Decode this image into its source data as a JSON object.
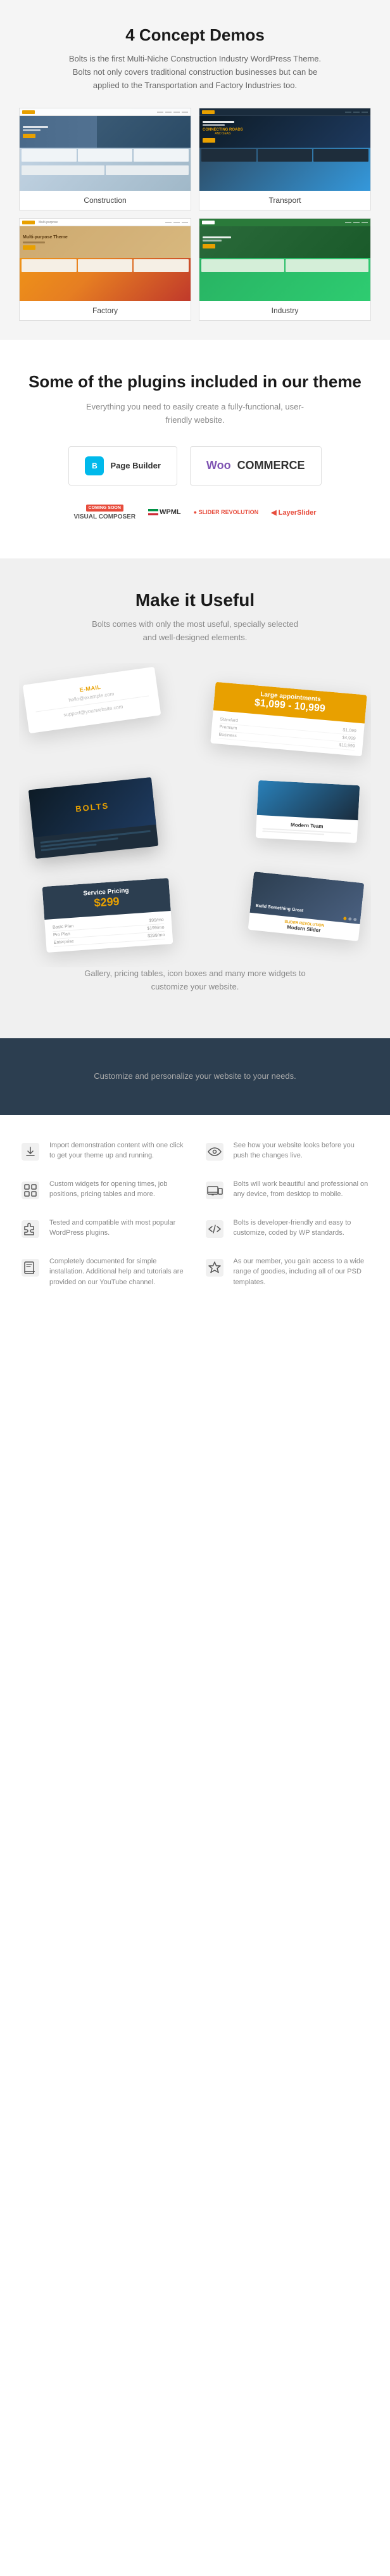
{
  "section_demos": {
    "title": "4 Concept Demos",
    "description": "Bolts is the first Multi-Niche Construction Industry WordPress Theme. Bolts not only covers traditional construction businesses but can be applied to the Transportation and Factory Industries too.",
    "demos": [
      {
        "id": "construction",
        "label": "Construction",
        "theme": "construction"
      },
      {
        "id": "transport",
        "label": "Transport",
        "theme": "transport"
      },
      {
        "id": "factory",
        "label": "Factory",
        "theme": "factory"
      },
      {
        "id": "industry",
        "label": "Industry",
        "theme": "industry"
      }
    ]
  },
  "section_plugins": {
    "title": "Some of the plugins included in our theme",
    "description": "Everything you need to easily create a fully-functional, user-friendly website.",
    "plugins": [
      {
        "id": "page-builder",
        "label": "Page Builder"
      },
      {
        "id": "woocommerce",
        "label": "WooCommerce"
      }
    ],
    "additional_plugins": [
      {
        "id": "visual-composer",
        "label": "Visual Composer",
        "badge": "COMING SOON"
      },
      {
        "id": "wpml",
        "label": "WPML"
      },
      {
        "id": "slider-revolution",
        "label": "SLIDER REVOLUTION"
      },
      {
        "id": "layer-slider",
        "label": "LayerSlider"
      }
    ]
  },
  "section_useful": {
    "title": "Make it Useful",
    "description": "Bolts comes with only the most useful, specially selected and well-designed elements.",
    "caption": "Gallery, pricing tables, icon boxes and many more widgets to customize your website.",
    "elements": {
      "email": {
        "label": "E-Mail",
        "value1": "hello@example.com",
        "value2": "support@yourwebsite.com"
      },
      "appointments": {
        "title": "Large appointments",
        "price_range": "$1,099 - 10,999",
        "rows": [
          {
            "label": "Standard",
            "value": "$1,099"
          },
          {
            "label": "Premium",
            "value": "$4,999"
          },
          {
            "label": "Business",
            "value": "$10,999"
          }
        ]
      },
      "pricing": {
        "title": "Service Pricing",
        "amount": "$299",
        "rows": [
          {
            "label": "Basic Plan",
            "value": "$99/mo"
          },
          {
            "label": "Pro Plan",
            "value": "$199/mo"
          },
          {
            "label": "Enterprise",
            "value": "$299/mo"
          }
        ]
      },
      "slider": {
        "tag": "SLIDER REVOLUTION",
        "title": "Modern Slider",
        "hero_text": "Build Something Great"
      },
      "dark_site": {
        "logo_text": "BOLTS",
        "lines": 3
      },
      "team": {
        "title": "Modern Team",
        "lines": 2
      }
    }
  },
  "section_customize": {
    "description": "Customize and personalize your website to your needs."
  },
  "section_features": {
    "features": [
      {
        "id": "demo-import",
        "icon": "download",
        "title": "Import demonstration content with one click to get your theme up and running.",
        "description": ""
      },
      {
        "id": "preview",
        "icon": "eye",
        "title": "See how your website looks before you push the changes live.",
        "description": ""
      },
      {
        "id": "custom-widgets",
        "icon": "grid",
        "title": "Custom widgets for opening times, job positions, pricing tables and more.",
        "description": ""
      },
      {
        "id": "responsive",
        "icon": "devices",
        "title": "Bolts will work beautiful and professional on any device, from desktop to mobile.",
        "description": ""
      },
      {
        "id": "compatible",
        "icon": "puzzle",
        "title": "Tested and compatible with most popular WordPress plugins.",
        "description": ""
      },
      {
        "id": "developer",
        "icon": "code",
        "title": "Bolts is developer-friendly and easy to customize, coded by WP standards.",
        "description": ""
      },
      {
        "id": "documented",
        "icon": "book",
        "title": "Completely documented for simple installation. Additional help and tutorials are provided on our YouTube channel.",
        "description": ""
      },
      {
        "id": "member",
        "icon": "star",
        "title": "As our member, you gain access to a wide range of goodies, including all of our PSD templates.",
        "description": ""
      }
    ]
  }
}
